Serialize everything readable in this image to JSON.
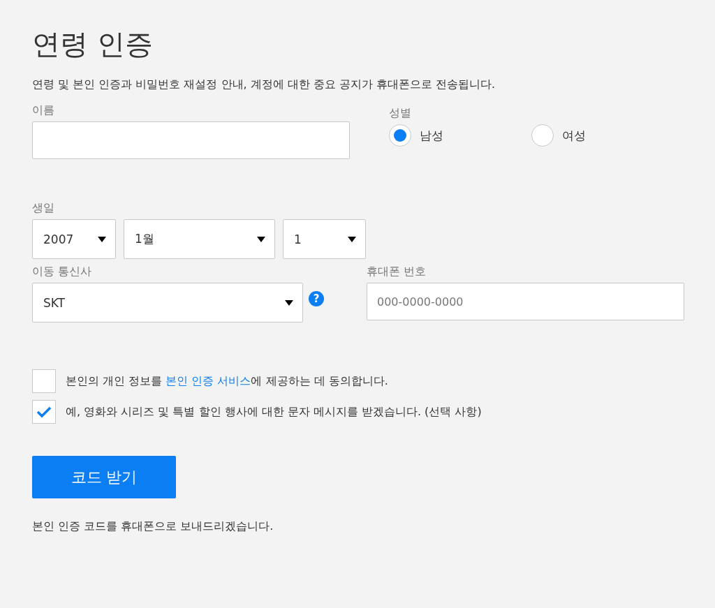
{
  "title": "연령 인증",
  "description": "연령 및 본인 인증과 비밀번호 재설정 안내, 계정에 대한 중요 공지가 휴대폰으로 전송됩니다.",
  "name_field": {
    "label": "이름"
  },
  "gender": {
    "label": "성별",
    "options": [
      {
        "label": "남성",
        "selected": true
      },
      {
        "label": "여성",
        "selected": false
      }
    ]
  },
  "birthday": {
    "label": "생일",
    "selects": [
      {
        "value": "2007"
      },
      {
        "value": "1월"
      },
      {
        "value": "1"
      }
    ]
  },
  "carrier": {
    "label": "이동 통신사",
    "value": "SKT",
    "help": "?"
  },
  "phone": {
    "label": "휴대폰 번호",
    "placeholder": "000-0000-0000"
  },
  "consents": [
    {
      "checked": false,
      "before": "본인의 개인 정보를 ",
      "link": "본인 인증 서비스",
      "after": "에 제공하는 데 동의합니다."
    },
    {
      "checked": true,
      "before": "예, 영화와 시리즈 및 특별 할인 행사에 대한 문자 메시지를 받겠습니다. (선택 사항)"
    }
  ],
  "submit_button": "코드 받기",
  "footer_note": "본인 인증 코드를 휴대폰으로 보내드리겠습니다."
}
